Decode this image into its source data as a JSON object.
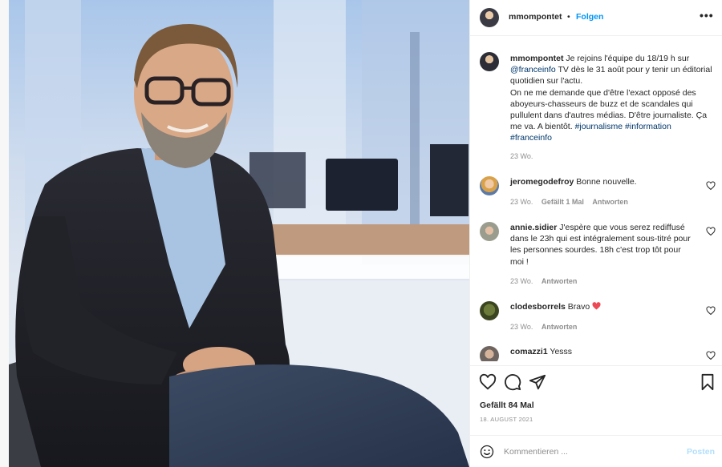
{
  "post": {
    "username": "mmompontet",
    "separator": "•",
    "follow_label": "Folgen",
    "more_label": "•••",
    "caption": {
      "username": "mmompontet",
      "t1": " Je rejoins l'équipe du 18/19 h sur ",
      "mention": "@franceinfo",
      "t2": " TV dès le 31 août pour y tenir un éditorial quotidien sur l'actu.",
      "t3": "On ne me demande que d'être l'exact opposé des aboyeurs-chasseurs de buzz et de scandales qui pullulent dans d'autres médias. D'être journaliste. Ça me va. A bientôt. ",
      "tag1": "#journalisme",
      "tag2": "#information",
      "tag3": "#franceinfo",
      "time": "23 Wo."
    },
    "comments": [
      {
        "username": "jeromegodefroy",
        "text": " Bonne nouvelle.",
        "time": "23 Wo.",
        "likes": "Gefällt 1 Mal",
        "reply": "Antworten"
      },
      {
        "username": "annie.sidier",
        "text": " J'espère que vous serez rediffusé dans le 23h qui est intégralement sous-titré pour les personnes sourdes. 18h c'est trop tôt pour moi !",
        "time": "23 Wo.",
        "reply": "Antworten"
      },
      {
        "username": "clodesborrels",
        "text": " Bravo ",
        "time": "23 Wo.",
        "reply": "Antworten"
      },
      {
        "username": "comazzi1",
        "text": " Yesss"
      }
    ],
    "likes_text": "Gefällt 84 Mal",
    "date": "18. AUGUST 2021",
    "comment_placeholder": "Kommentieren ...",
    "post_button": "Posten"
  },
  "icons": {
    "heart": "heart-icon",
    "comment": "comment-icon",
    "share": "share-icon",
    "bookmark": "bookmark-icon",
    "emoji": "emoji-icon"
  },
  "colors": {
    "link": "#00376b",
    "follow": "#0095f6",
    "muted": "#8e8e8e",
    "heart_red": "#ed4956",
    "post_disabled": "#b2dffc"
  }
}
